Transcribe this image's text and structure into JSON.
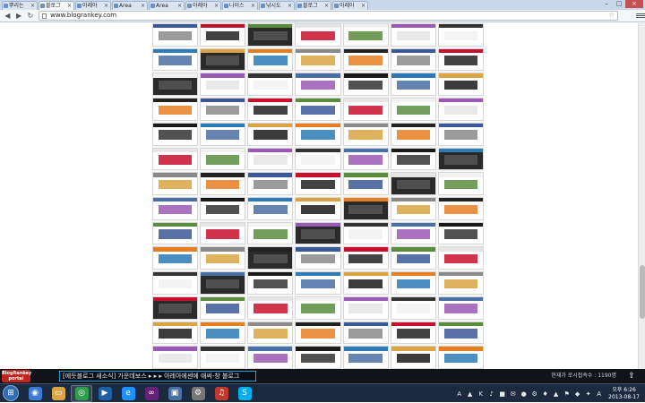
{
  "browser": {
    "tabs": [
      {
        "label": "뿌리는"
      },
      {
        "label": "블로그",
        "active": true
      },
      {
        "label": "아레아"
      },
      {
        "label": "Area"
      },
      {
        "label": "Area"
      },
      {
        "label": "아레아"
      },
      {
        "label": "나이스"
      },
      {
        "label": "낚시도"
      },
      {
        "label": "블로그"
      },
      {
        "label": "아레아"
      }
    ],
    "url": "www.blogrankey.com",
    "window_controls": {
      "minimize": "–",
      "maximize": "□",
      "close": "×"
    }
  },
  "thumbnails": {
    "rows": 14,
    "cols": 7,
    "colors": [
      "#3b5998",
      "#e5e5e5",
      "#333333",
      "#2c7bb6",
      "#8a8a8a",
      "#c8102e",
      "#f2f2f2",
      "#4a6fa5",
      "#d9a441",
      "#222222",
      "#5b8c3e",
      "#9b59b6",
      "#1a1a1a",
      "#e67e22"
    ]
  },
  "ticker": {
    "logo_text": "BlogRankey portal",
    "headline": "[에듯블로그 새소식] 가운데보스 ▸ ▸ ▸ 아레아에센에 애써-창 블로그",
    "visitor_count": "현재가 로시접속수 : 1190명"
  },
  "taskbar": {
    "apps": [
      "explorer",
      "folder",
      "chrome",
      "media",
      "ie",
      "visual-studio",
      "photo",
      "settings",
      "sound",
      "skype"
    ],
    "tray_icons": [
      "A",
      "▲",
      "K",
      "♪",
      "■",
      "✉",
      "●",
      "⚙",
      "♦",
      "▲",
      "⚑",
      "◆",
      "✦",
      "A"
    ],
    "clock_time": "오후 6:26",
    "clock_date": "2013-08-17"
  }
}
